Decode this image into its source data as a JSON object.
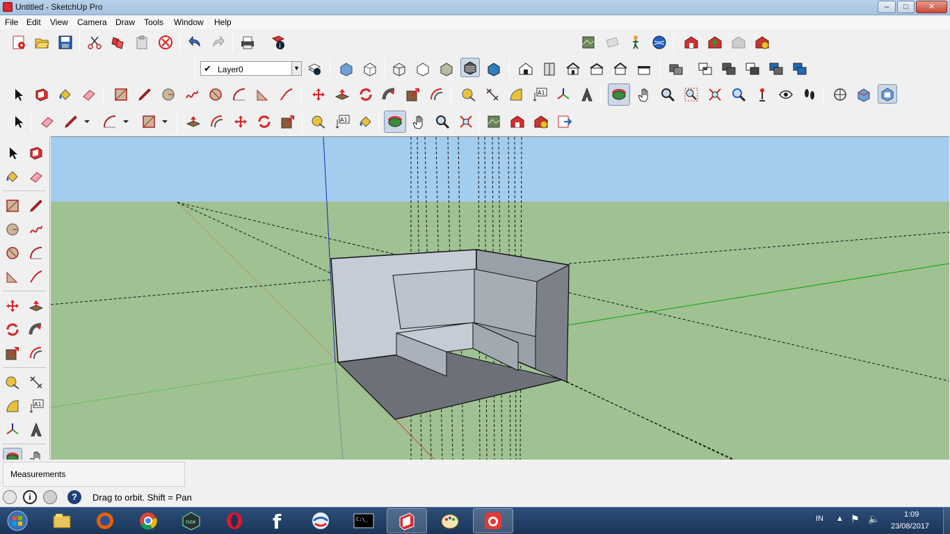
{
  "window": {
    "title": "Untitled - SketchUp Pro",
    "controls": [
      "minimize",
      "maximize",
      "close"
    ]
  },
  "menubar": {
    "items": [
      "File",
      "Edit",
      "View",
      "Camera",
      "Draw",
      "Tools",
      "Window",
      "Help"
    ]
  },
  "layers": {
    "current": "Layer0",
    "checked": true
  },
  "measurements": {
    "label": "Measurements",
    "value": ""
  },
  "status": {
    "message": "Drag to orbit.  Shift = Pan"
  },
  "taskbar": {
    "apps": [
      "Windows Explorer",
      "Firefox",
      "Chrome",
      "Nox",
      "Opera",
      "Facebook",
      "Browser",
      "Command Prompt",
      "SketchUp",
      "Paint",
      "Photo app"
    ],
    "language": "IN",
    "time": "1:09",
    "date": "23/08/2017"
  },
  "colors": {
    "sky": "#a3cdef",
    "ground": "#a0c192",
    "model_face": "#c5ccd5",
    "model_dark": "#6b7079",
    "axis_red": "#c44",
    "axis_green": "#0a0",
    "axis_blue": "#22a"
  }
}
